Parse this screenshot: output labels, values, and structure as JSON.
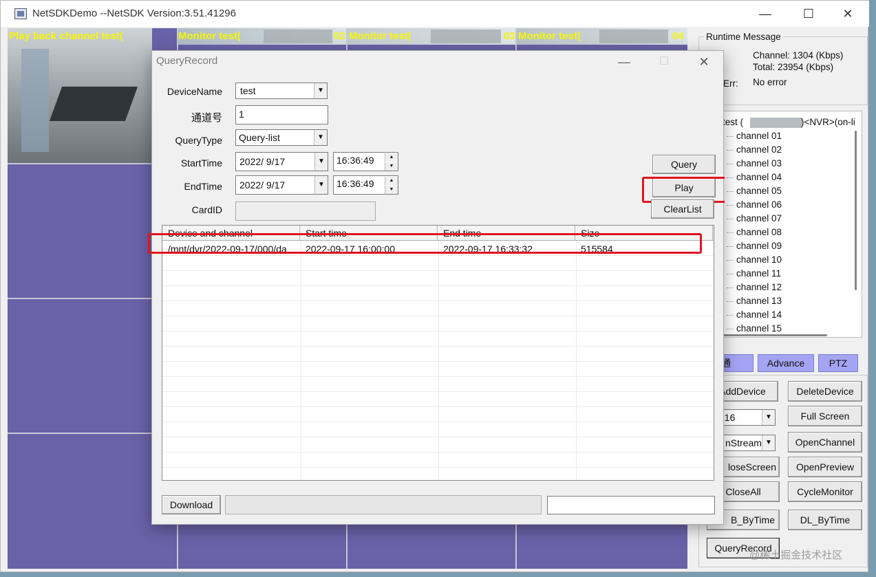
{
  "window": {
    "title": "NetSDKDemo  --NetSDK Version:3.51.41296",
    "minimize_icon": "minimize-icon",
    "maximize_icon": "maximize-icon",
    "close_icon": "close-icon"
  },
  "video": {
    "cells": [
      {
        "label": "Play back channel test("
      },
      {
        "label": "Monitor test(",
        "suffix": "02"
      },
      {
        "label": "Monitor test(",
        "suffix": "03"
      },
      {
        "label": "Monitor test(",
        "suffix": "04"
      }
    ]
  },
  "runtime": {
    "title": "Runtime Message",
    "channel": "Channel: 1304 (Kbps)",
    "total": "Total: 23954 (Kbps)",
    "err_label": "Err:",
    "err_value": "No error"
  },
  "device_tree": {
    "root": "test (",
    "root_suffix": ")<NVR>(on-li",
    "channels": [
      "channel 01",
      "channel 02",
      "channel 03",
      "channel 04",
      "channel 05",
      "channel 06",
      "channel 07",
      "channel 08",
      "channel 09",
      "channel 10",
      "channel 11",
      "channel 12",
      "channel 13",
      "channel 14",
      "channel 15"
    ]
  },
  "tabs": {
    "normal": "通",
    "advance": "Advance",
    "ptz": "PTZ"
  },
  "right_buttons": {
    "add_device": "AddDevice",
    "delete_device": "DeleteDevice",
    "split_combo": "-16",
    "full_screen": "Full Screen",
    "stream_combo": "nStream",
    "open_channel": "OpenChannel",
    "close_screen": "loseScreen",
    "open_preview": "OpenPreview",
    "close_all": "CloseAll",
    "cycle_monitor": "CycleMonitor",
    "pb_bytime": "B_ByTime",
    "dl_bytime": "DL_ByTime",
    "query_record": "QueryRecord"
  },
  "watermark": "@稀土掘金技术社区",
  "dialog": {
    "title": "QueryRecord",
    "device_name_label": "DeviceName",
    "device_name_value": "test",
    "channel_label": "通道号",
    "channel_value": "1",
    "query_type_label": "QueryType",
    "query_type_value": "Query-list",
    "start_time_label": "StartTime",
    "start_date": "2022/  9/17",
    "start_time": "16:36:49",
    "end_time_label": "EndTime",
    "end_date": "2022/  9/17",
    "end_time": "16:36:49",
    "card_id_label": "CardID",
    "card_id_value": "",
    "query_button": "Query",
    "play_button": "Play",
    "clear_button": "ClearList",
    "download_button": "Download",
    "columns": [
      "Device and channel",
      "Start time",
      "End time",
      "Size"
    ],
    "rows": [
      [
        "/mnt/dvr/2022-09-17/000/da",
        "2022-09-17 16:00:00",
        "2022-09-17 16:33:32",
        "515584"
      ]
    ]
  },
  "colors": {
    "video_bg": "#6a62a8",
    "label_yellow": "#f6f600",
    "tab_bg": "#a4a4f4",
    "highlight_red": "#e0141e"
  }
}
